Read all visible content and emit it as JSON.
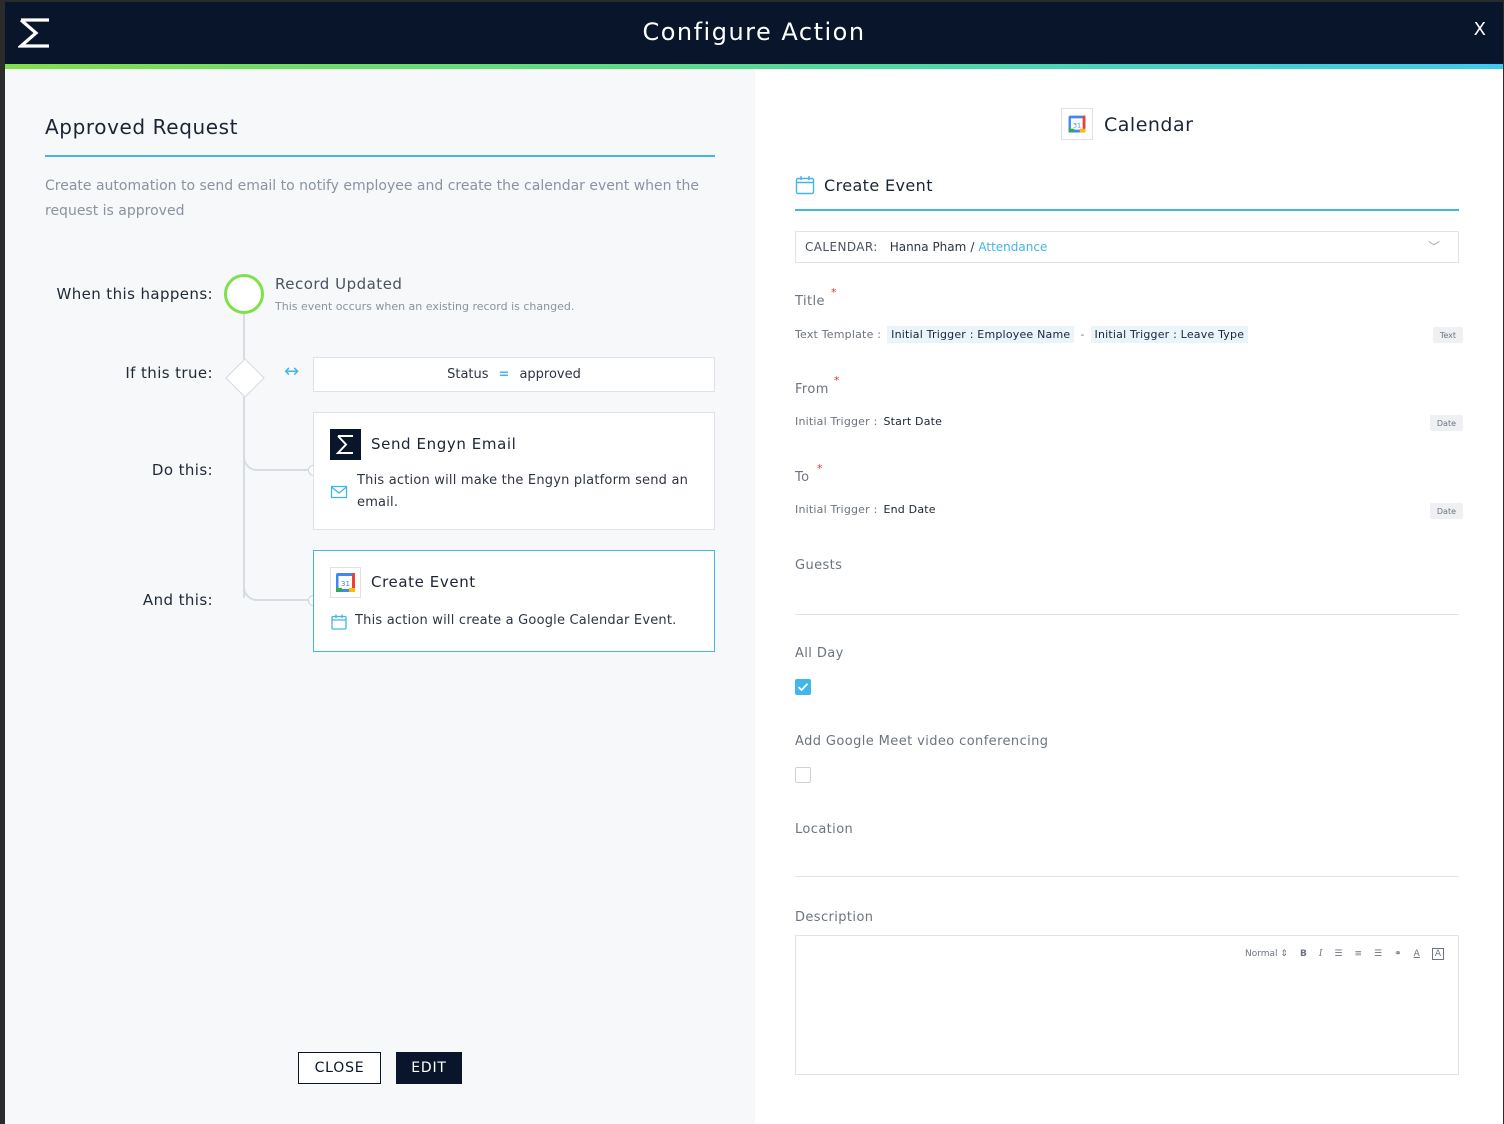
{
  "header": {
    "title": "Configure Action",
    "close_label": "X"
  },
  "left": {
    "title": "Approved Request",
    "description": "Create automation to send email to notify employee and create the calendar event when the request is approved",
    "labels": {
      "when": "When this happens:",
      "if": "If this true:",
      "do": "Do this:",
      "and": "And this:"
    },
    "trigger": {
      "title": "Record Updated",
      "subtitle": "This event occurs when an existing record is changed."
    },
    "condition": {
      "field": "Status",
      "operator": "=",
      "value": "approved"
    },
    "actions": [
      {
        "title": "Send Engyn Email",
        "description": "This action will make the Engyn platform send an email."
      },
      {
        "title": "Create Event",
        "description": "This action will create a Google Calendar Event."
      }
    ],
    "buttons": {
      "close": "CLOSE",
      "edit": "EDIT"
    }
  },
  "right": {
    "app_name": "Calendar",
    "action_title": "Create Event",
    "calendar": {
      "label": "CALENDAR:",
      "user": "Hanna Pham",
      "separator": "/",
      "calendar_name": "Attendance"
    },
    "title_field": {
      "label": "Title",
      "required_mark": "*",
      "prefix": "Text Template :",
      "chip1": "Initial Trigger : Employee Name",
      "separator": "-",
      "chip2": "Initial Trigger : Leave Type",
      "type": "Text"
    },
    "from_field": {
      "label": "From",
      "required_mark": "*",
      "prefix": "Initial Trigger :",
      "value": "Start Date",
      "type": "Date"
    },
    "to_field": {
      "label": "To",
      "required_mark": "*",
      "prefix": "Initial Trigger :",
      "value": "End Date",
      "type": "Date"
    },
    "guests_label": "Guests",
    "all_day": {
      "label": "All Day",
      "checked": true
    },
    "meet": {
      "label": "Add Google Meet video conferencing",
      "checked": false
    },
    "location_label": "Location",
    "description": {
      "label": "Description",
      "format": "Normal"
    }
  },
  "colors": {
    "accent": "#43b5e6",
    "header_bg": "#09152a",
    "trigger_ring": "#7fe04a",
    "required": "#e0332e"
  }
}
